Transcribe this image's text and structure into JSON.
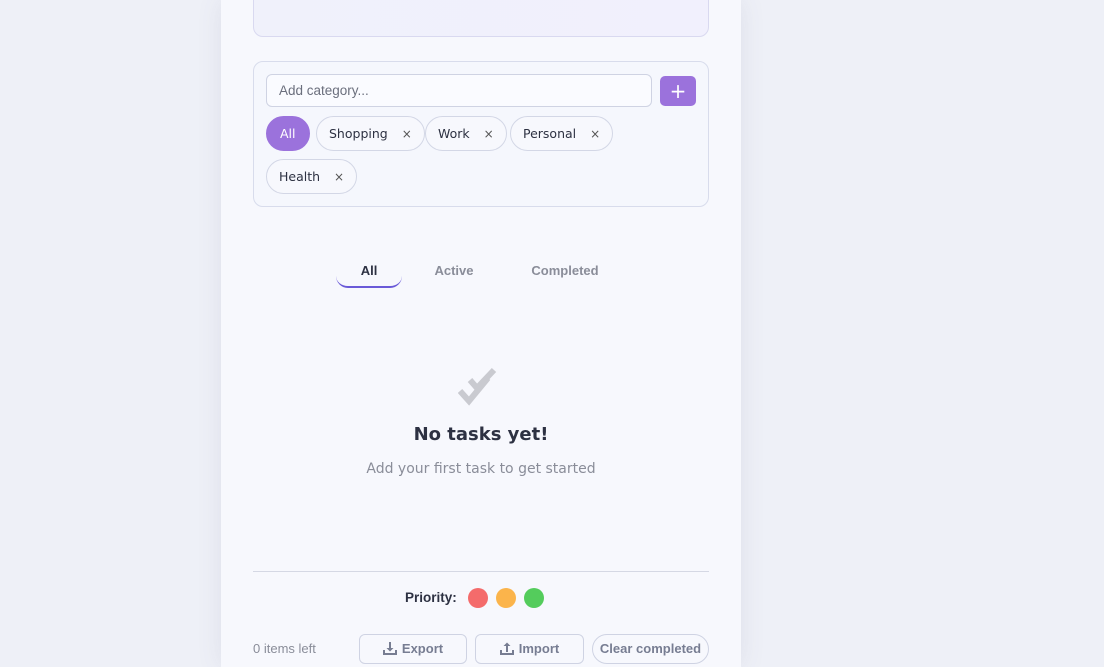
{
  "categories": {
    "input_placeholder": "Add category...",
    "add_label": "+",
    "chips": [
      {
        "label": "All",
        "active": true
      },
      {
        "label": "Shopping",
        "remove": "×"
      },
      {
        "label": "Work",
        "remove": "×"
      },
      {
        "label": "Personal",
        "remove": "×"
      },
      {
        "label": "Health",
        "remove": "×"
      }
    ]
  },
  "filter_tabs": [
    {
      "label": "All",
      "active": true
    },
    {
      "label": "Active"
    },
    {
      "label": "Completed"
    }
  ],
  "empty_state": {
    "icon": "double-check-icon",
    "title": "No tasks yet!",
    "subtitle": "Add your first task to get started"
  },
  "priority": {
    "label": "Priority:",
    "colors": [
      "#f46b6b",
      "#fbb44b",
      "#54cc5c"
    ]
  },
  "footer": {
    "items_left": "0 items left",
    "export_label": "Export",
    "import_label": "Import",
    "clear_label": "Clear completed"
  },
  "colors": {
    "accent": "#9b72dc",
    "tab_underline": "#6a5ad8"
  }
}
